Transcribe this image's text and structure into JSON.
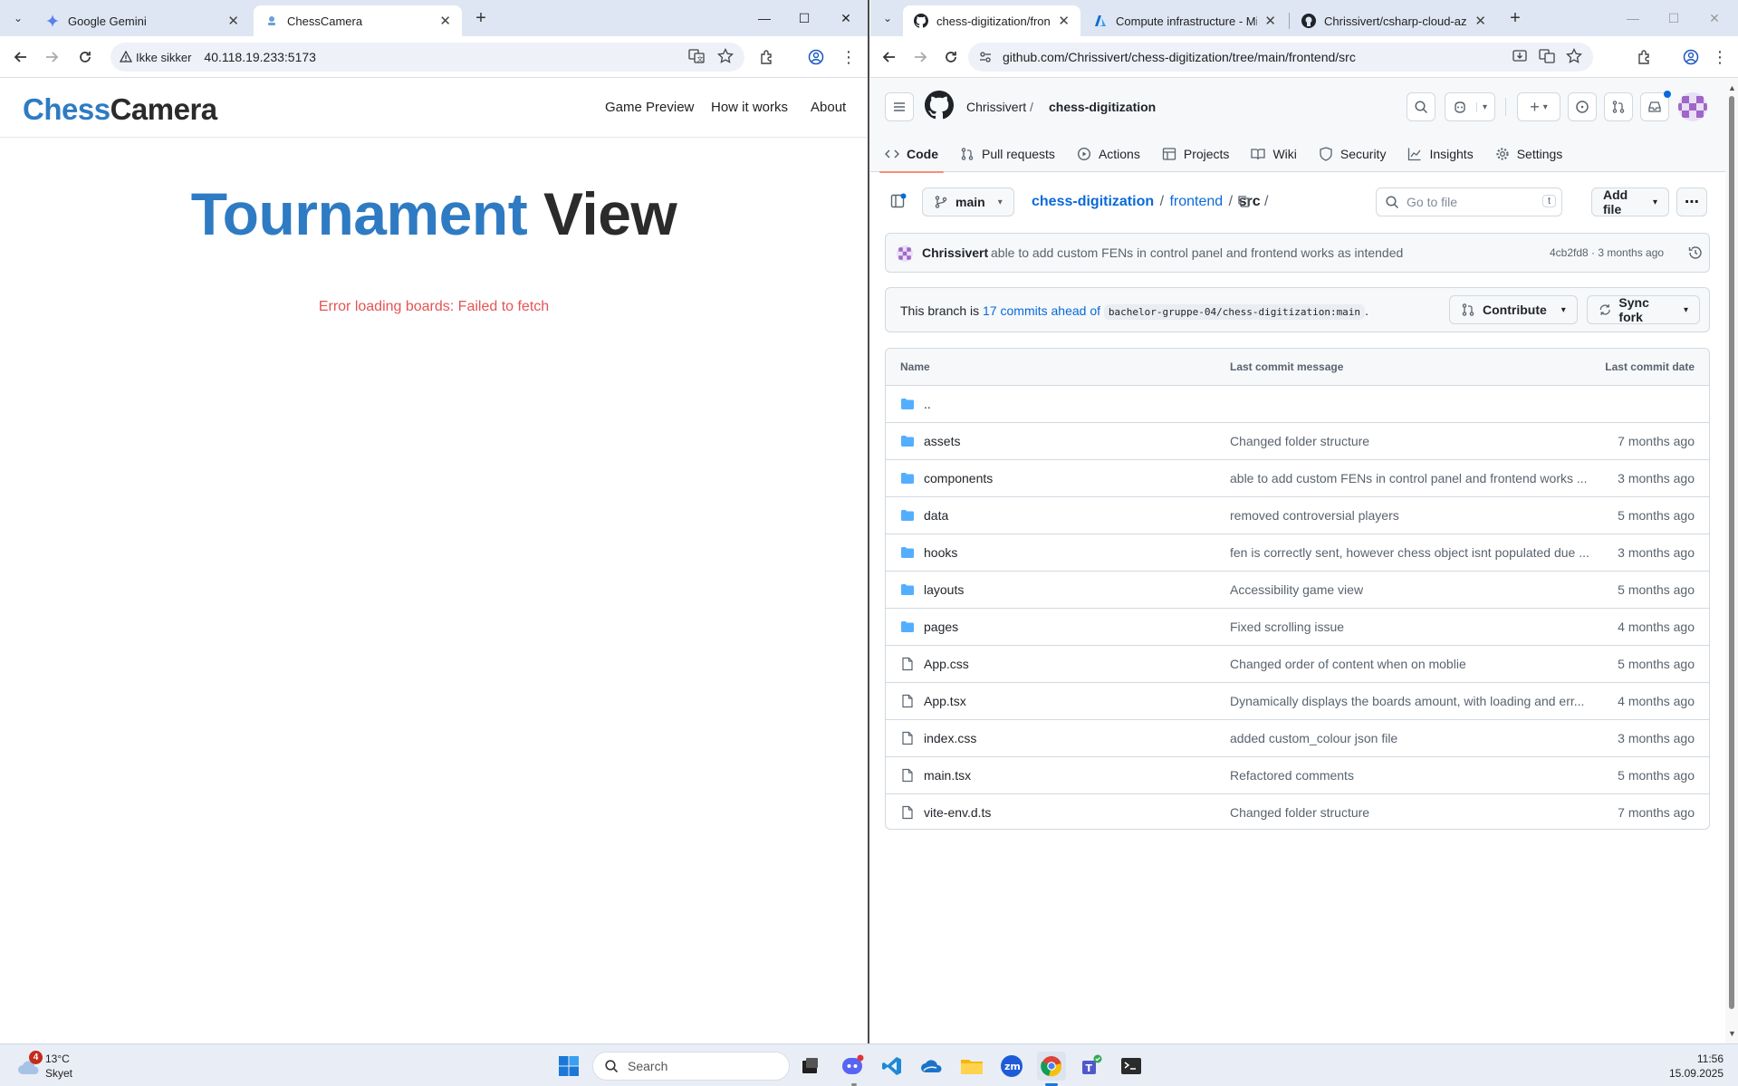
{
  "left_window": {
    "tabs": [
      {
        "title": "Google Gemini",
        "active": false
      },
      {
        "title": "ChessCamera",
        "active": true
      }
    ],
    "url": "40.118.19.233:5173",
    "security_label": "Ikke sikker",
    "page": {
      "logo_part1": "Chess",
      "logo_part2": "Camera",
      "nav": [
        "Game Preview",
        "How it works",
        "About"
      ],
      "title_part1": "Tournament",
      "title_part2": "View",
      "error": "Error loading boards: Failed to fetch"
    }
  },
  "right_window": {
    "tabs": [
      {
        "title": "chess-digitization/frontend/src",
        "active": true
      },
      {
        "title": "Compute infrastructure - Micro",
        "active": false
      },
      {
        "title": "Chrissivert/csharp-cloud-azure",
        "active": false
      }
    ],
    "url": "github.com/Chrissivert/chess-digitization/tree/main/frontend/src",
    "repo": {
      "owner": "Chrissivert",
      "separator": "/",
      "name": "chess-digitization"
    },
    "nav_tabs": [
      "Code",
      "Pull requests",
      "Actions",
      "Projects",
      "Wiki",
      "Security",
      "Insights",
      "Settings"
    ],
    "branch": "main",
    "path": {
      "repo": "chess-digitization",
      "sep": "/",
      "folder": "frontend",
      "current": "src",
      "trailing": "/"
    },
    "go_to_file_placeholder": "Go to file",
    "go_to_file_key": "t",
    "add_file": "Add file",
    "latest_commit": {
      "author": "Chrissivert",
      "message": "able to add custom FENs in control panel and frontend works as intended",
      "meta": "4cb2fd8 · 3 months ago"
    },
    "branch_status": {
      "prefix": "This branch is ",
      "link": "17 commits ahead of",
      "upstream": "bachelor-gruppe-04/chess-digitization:main",
      "suffix": "."
    },
    "contribute": "Contribute",
    "sync_fork": "Sync fork",
    "table_headers": {
      "name": "Name",
      "message": "Last commit message",
      "date": "Last commit date"
    },
    "parent_dir": "..",
    "files": [
      {
        "name": "assets",
        "type": "folder",
        "message": "Changed folder structure",
        "date": "7 months ago"
      },
      {
        "name": "components",
        "type": "folder",
        "message": "able to add custom FENs in control panel and frontend works ...",
        "date": "3 months ago"
      },
      {
        "name": "data",
        "type": "folder",
        "message": "removed controversial players",
        "date": "5 months ago"
      },
      {
        "name": "hooks",
        "type": "folder",
        "message": "fen is correctly sent, however chess object isnt populated due ...",
        "date": "3 months ago"
      },
      {
        "name": "layouts",
        "type": "folder",
        "message": "Accessibility game view",
        "date": "5 months ago"
      },
      {
        "name": "pages",
        "type": "folder",
        "message": "Fixed scrolling issue",
        "date": "4 months ago"
      },
      {
        "name": "App.css",
        "type": "file",
        "message": "Changed order of content when on moblie",
        "date": "5 months ago"
      },
      {
        "name": "App.tsx",
        "type": "file",
        "message": "Dynamically displays the boards amount, with loading and err...",
        "date": "4 months ago"
      },
      {
        "name": "index.css",
        "type": "file",
        "message": "added custom_colour json file",
        "date": "3 months ago"
      },
      {
        "name": "main.tsx",
        "type": "file",
        "message": "Refactored comments",
        "date": "5 months ago"
      },
      {
        "name": "vite-env.d.ts",
        "type": "file",
        "message": "Changed folder structure",
        "date": "7 months ago"
      }
    ]
  },
  "taskbar": {
    "weather_temp": "13°C",
    "weather_desc": "Skyet",
    "weather_badge": "4",
    "search_placeholder": "Search",
    "time": "11:56",
    "date": "15.09.2025"
  },
  "colors": {
    "chess_blue": "#2f7bc3",
    "error_red": "#e55353",
    "github_link": "#0969da",
    "tab_underline": "#fd8c73"
  }
}
